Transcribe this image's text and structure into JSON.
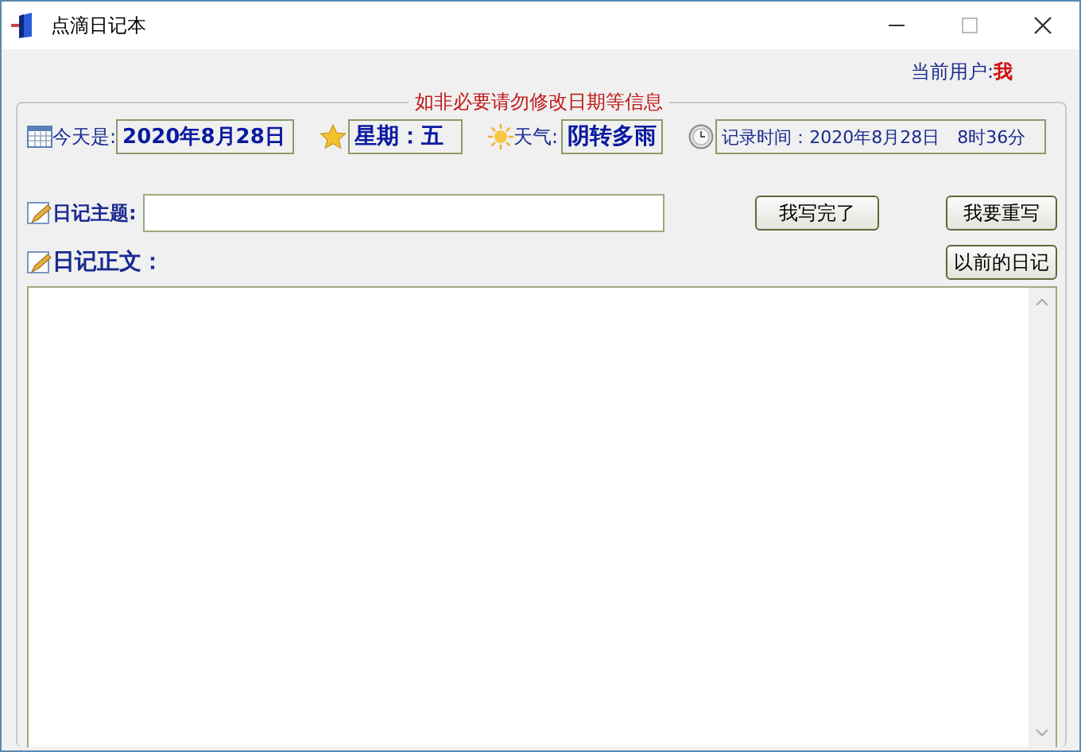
{
  "window": {
    "title": "点滴日记本"
  },
  "current_user": {
    "label": "当前用户:",
    "value": "我"
  },
  "group": {
    "legend": "如非必要请勿修改日期等信息"
  },
  "info": {
    "today_label": "今天是:",
    "today": "2020年8月28日",
    "weekday": "星期：五",
    "weather_label": "天气:",
    "weather": "阴转多雨",
    "record_time": "记录时间：2020年8月28日　8时36分"
  },
  "subject": {
    "label": "日记主题:"
  },
  "buttons": [
    {
      "label": "我写完了"
    },
    {
      "label": "我要重写"
    },
    {
      "label": "以前的日记"
    }
  ],
  "body": {
    "label": "日记正文："
  }
}
